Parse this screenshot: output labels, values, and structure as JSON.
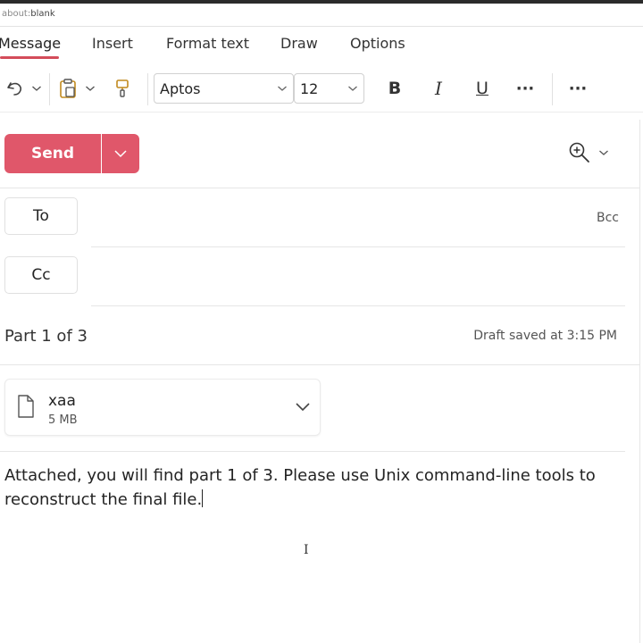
{
  "browser": {
    "url_prefix": "about:",
    "url_rest": "blank"
  },
  "tabs": [
    {
      "label": "Message",
      "active": true
    },
    {
      "label": "Insert"
    },
    {
      "label": "Format text"
    },
    {
      "label": "Draw"
    },
    {
      "label": "Options"
    }
  ],
  "ribbon": {
    "font_name": "Aptos",
    "font_size": "12",
    "bold_label": "B",
    "italic_label": "I",
    "underline_label": "U",
    "more_label": "···",
    "overflow_label": "···"
  },
  "compose": {
    "send_label": "Send",
    "to_label": "To",
    "cc_label": "Cc",
    "bcc_label": "Bcc",
    "subject": "Part 1 of 3",
    "draft_status": "Draft saved at 3:15 PM",
    "attachment": {
      "name": "xaa",
      "size": "5 MB"
    },
    "body": "Attached, you will find part 1 of 3.  Please use Unix command-line tools to reconstruct the final file."
  },
  "colors": {
    "accent": "#e0576a",
    "tab_underline": "#d44c5a"
  }
}
